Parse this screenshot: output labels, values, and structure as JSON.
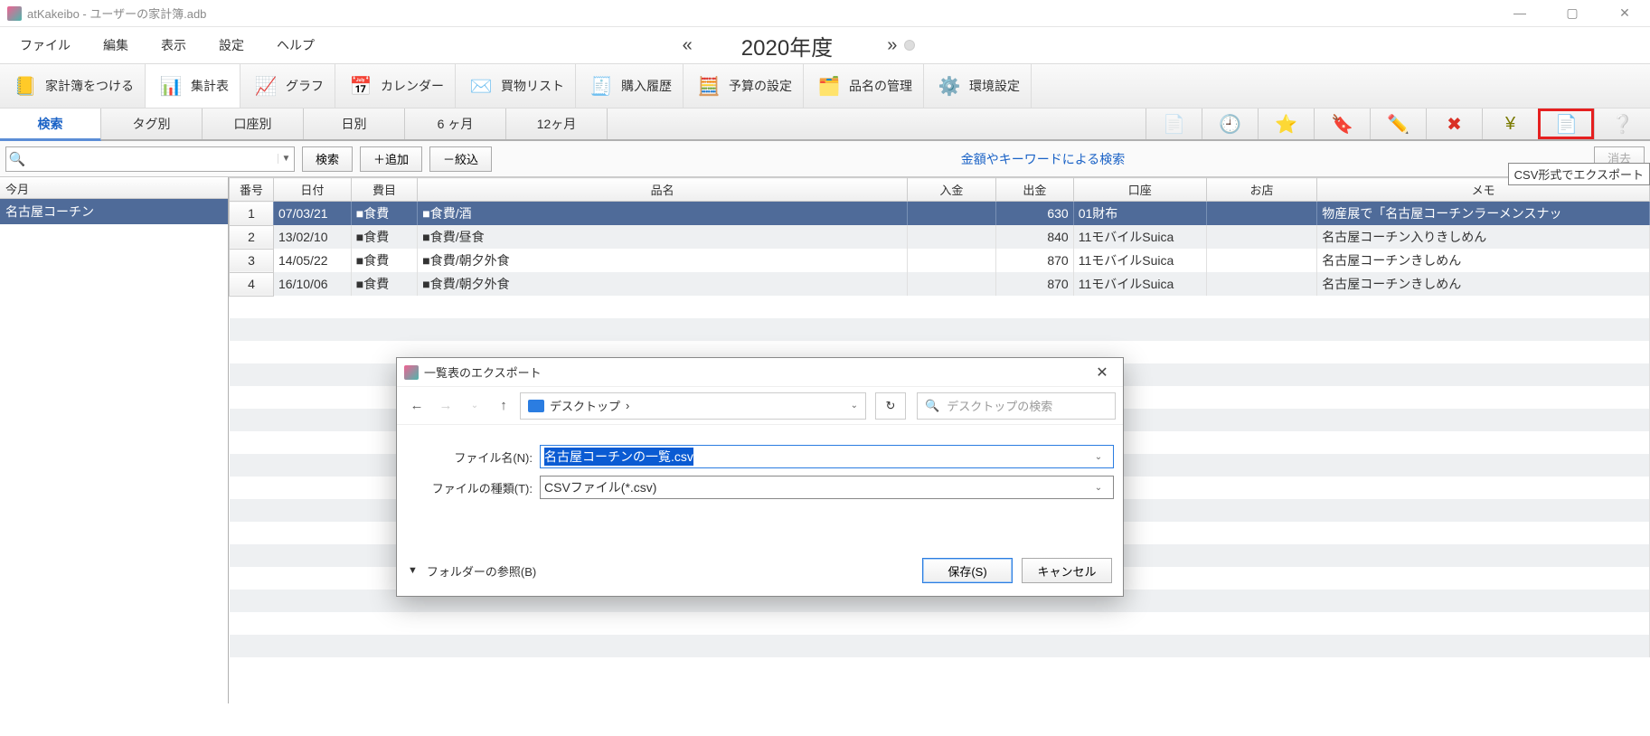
{
  "titlebar": {
    "app_title": "atKakeibo - ユーザーの家計簿.adb"
  },
  "menubar": {
    "items": [
      "ファイル",
      "編集",
      "表示",
      "設定",
      "ヘルプ"
    ],
    "prev": "«",
    "next": "»",
    "year": "2020年度"
  },
  "toolbar": {
    "items": [
      {
        "label": "家計簿をつける",
        "icon": "ledger-icon",
        "glyph": "📒"
      },
      {
        "label": "集計表",
        "icon": "summary-icon",
        "glyph": "📊",
        "active": true
      },
      {
        "label": "グラフ",
        "icon": "chart-icon",
        "glyph": "📈"
      },
      {
        "label": "カレンダー",
        "icon": "calendar-icon",
        "glyph": "📅"
      },
      {
        "label": "買物リスト",
        "icon": "shopping-icon",
        "glyph": "✉️"
      },
      {
        "label": "購入履歴",
        "icon": "history-icon",
        "glyph": "🧾"
      },
      {
        "label": "予算の設定",
        "icon": "budget-icon",
        "glyph": "🧮"
      },
      {
        "label": "品名の管理",
        "icon": "items-icon",
        "glyph": "🗂️"
      },
      {
        "label": "環境設定",
        "icon": "settings-icon",
        "glyph": "⚙️"
      }
    ]
  },
  "filtertabs": {
    "tabs": [
      "検索",
      "タグ別",
      "口座別",
      "日別",
      "6 ヶ月",
      "12ヶ月"
    ],
    "active_index": 0,
    "icons": [
      {
        "name": "copy-icon",
        "glyph": "📄",
        "disabled": true
      },
      {
        "name": "history-icon",
        "glyph": "🕘"
      },
      {
        "name": "star-icon",
        "glyph": "⭐"
      },
      {
        "name": "tag-icon",
        "glyph": "🔖"
      },
      {
        "name": "edit-icon",
        "glyph": "✏️"
      },
      {
        "name": "delete-icon",
        "glyph": "✖",
        "color": "#d93025"
      },
      {
        "name": "yen-icon",
        "glyph": "¥",
        "color": "#7a7a00"
      },
      {
        "name": "csv-export-icon",
        "glyph": "📄",
        "highlighted": true
      },
      {
        "name": "help-icon",
        "glyph": "❔",
        "color": "#1a73e8"
      }
    ],
    "tooltip": "CSV形式でエクスポート"
  },
  "searchrow": {
    "search_btn": "検索",
    "add_btn": "＋追加",
    "narrow_btn": "－絞込",
    "hint": "金額やキーワードによる検索",
    "clear_btn": "消去"
  },
  "sidepanel": {
    "header": "今月",
    "selected": "名古屋コーチン"
  },
  "table": {
    "headers": [
      "番号",
      "日付",
      "費目",
      "品名",
      "入金",
      "出金",
      "口座",
      "お店",
      "メモ"
    ],
    "rows": [
      {
        "num": "1",
        "date": "07/03/21",
        "cat": "■食費",
        "item": "■食費/酒",
        "in": "",
        "out": "630",
        "acct": "01財布",
        "shop": "",
        "memo": "物産展で「名古屋コーチンラーメンスナッ",
        "selected": true
      },
      {
        "num": "2",
        "date": "13/02/10",
        "cat": "■食費",
        "item": "■食費/昼食",
        "in": "",
        "out": "840",
        "acct": "11モバイルSuica",
        "shop": "",
        "memo": "名古屋コーチン入りきしめん"
      },
      {
        "num": "3",
        "date": "14/05/22",
        "cat": "■食費",
        "item": "■食費/朝夕外食",
        "in": "",
        "out": "870",
        "acct": "11モバイルSuica",
        "shop": "",
        "memo": "名古屋コーチンきしめん"
      },
      {
        "num": "4",
        "date": "16/10/06",
        "cat": "■食費",
        "item": "■食費/朝夕外食",
        "in": "",
        "out": "870",
        "acct": "11モバイルSuica",
        "shop": "",
        "memo": "名古屋コーチンきしめん"
      }
    ]
  },
  "dialog": {
    "title": "一覧表のエクスポート",
    "location": "デスクトップ",
    "location_chevron": "›",
    "search_placeholder": "デスクトップの検索",
    "filename_label": "ファイル名(N):",
    "filename_value": "名古屋コーチンの一覧.csv",
    "filetype_label": "ファイルの種類(T):",
    "filetype_value": "CSVファイル(*.csv)",
    "browse_label": "フォルダーの参照(B)",
    "save_btn": "保存(S)",
    "cancel_btn": "キャンセル"
  }
}
